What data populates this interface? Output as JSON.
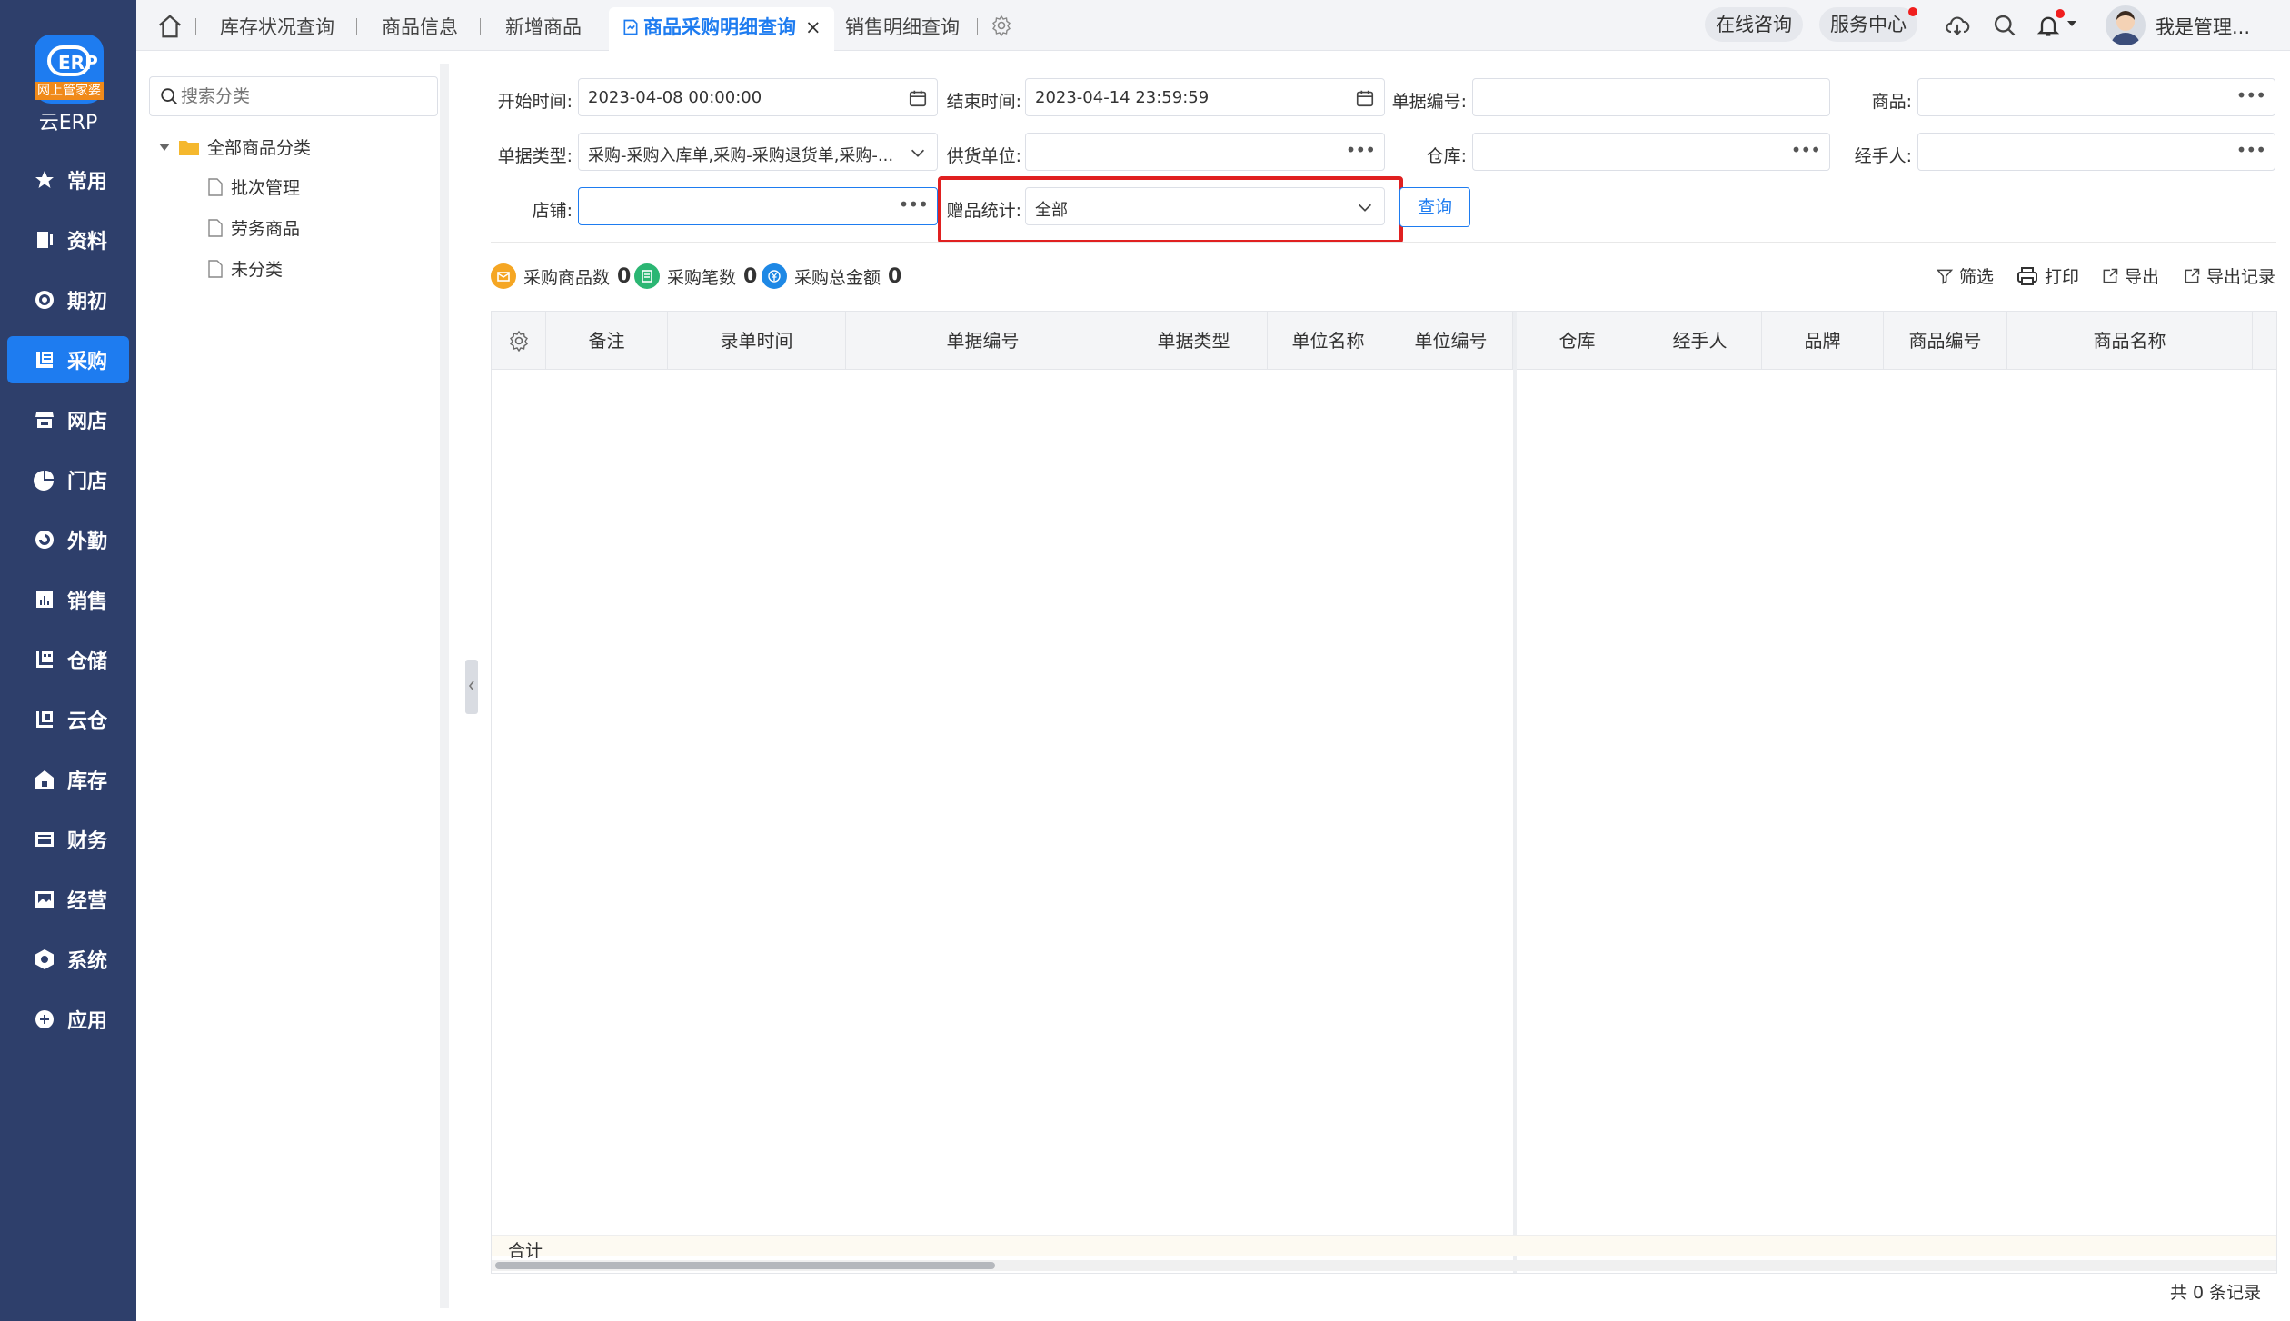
{
  "logo": {
    "glyph": "ERP",
    "strip_text": "网上管家婆",
    "app_name": "云ERP"
  },
  "nav": [
    {
      "label": "常用",
      "icon": "star-icon"
    },
    {
      "label": "资料",
      "icon": "document-icon"
    },
    {
      "label": "期初",
      "icon": "target-icon"
    },
    {
      "label": "采购",
      "icon": "purchase-icon",
      "active": true
    },
    {
      "label": "网店",
      "icon": "store-icon"
    },
    {
      "label": "门店",
      "icon": "pie-icon"
    },
    {
      "label": "外勤",
      "icon": "compass-icon"
    },
    {
      "label": "销售",
      "icon": "bar-chart-icon"
    },
    {
      "label": "仓储",
      "icon": "warehouse-icon"
    },
    {
      "label": "云仓",
      "icon": "cloud-warehouse-icon"
    },
    {
      "label": "库存",
      "icon": "home-icon"
    },
    {
      "label": "财务",
      "icon": "wallet-icon"
    },
    {
      "label": "经营",
      "icon": "picture-icon"
    },
    {
      "label": "系统",
      "icon": "hexagon-icon"
    },
    {
      "label": "应用",
      "icon": "plus-icon"
    }
  ],
  "tabs": {
    "inventory_status": "库存状况查询",
    "product_info": "商品信息",
    "new_product": "新增商品",
    "purchase_detail": "商品采购明细查询",
    "sales_detail": "销售明细查询",
    "close": "×"
  },
  "topbar": {
    "online_consult": "在线咨询",
    "service_center": "服务中心",
    "user_name": "我是管理..."
  },
  "category": {
    "search_placeholder": "搜索分类",
    "root": "全部商品分类",
    "children": [
      "批次管理",
      "劳务商品",
      "未分类"
    ]
  },
  "filters": {
    "start_time": {
      "label": "开始时间:",
      "value": "2023-04-08 00:00:00"
    },
    "end_time": {
      "label": "结束时间:",
      "value": "2023-04-14 23:59:59"
    },
    "bill_no": {
      "label": "单据编号:",
      "value": ""
    },
    "product": {
      "label": "商品:",
      "value": ""
    },
    "bill_type": {
      "label": "单据类型:",
      "value": "采购-采购入库单,采购-采购退货单,采购-..."
    },
    "supplier": {
      "label": "供货单位:",
      "value": ""
    },
    "warehouse": {
      "label": "仓库:",
      "value": ""
    },
    "handler": {
      "label": "经手人:",
      "value": ""
    },
    "shop": {
      "label": "店铺:",
      "value": ""
    },
    "gift_stat": {
      "label": "赠品统计:",
      "value": "全部"
    },
    "query_btn": "查询"
  },
  "stats": [
    {
      "label": "采购商品数",
      "value": "0",
      "color": "#f5a623"
    },
    {
      "label": "采购笔数",
      "value": "0",
      "color": "#2bb673"
    },
    {
      "label": "采购总金额",
      "value": "0",
      "color": "#1e88e5"
    }
  ],
  "tools": {
    "filter": "筛选",
    "print": "打印",
    "export": "导出",
    "export_log": "导出记录"
  },
  "table": {
    "columns": [
      "备注",
      "录单时间",
      "单据编号",
      "单据类型",
      "单位名称",
      "单位编号",
      "仓库",
      "经手人",
      "品牌",
      "商品编号",
      "商品名称"
    ],
    "rows": [],
    "sum_label": "合计",
    "record_count": "共 0 条记录"
  },
  "colors": {
    "accent": "#1e7cf0",
    "nav_bg": "#2e3f6b",
    "highlight": "#e02020"
  }
}
